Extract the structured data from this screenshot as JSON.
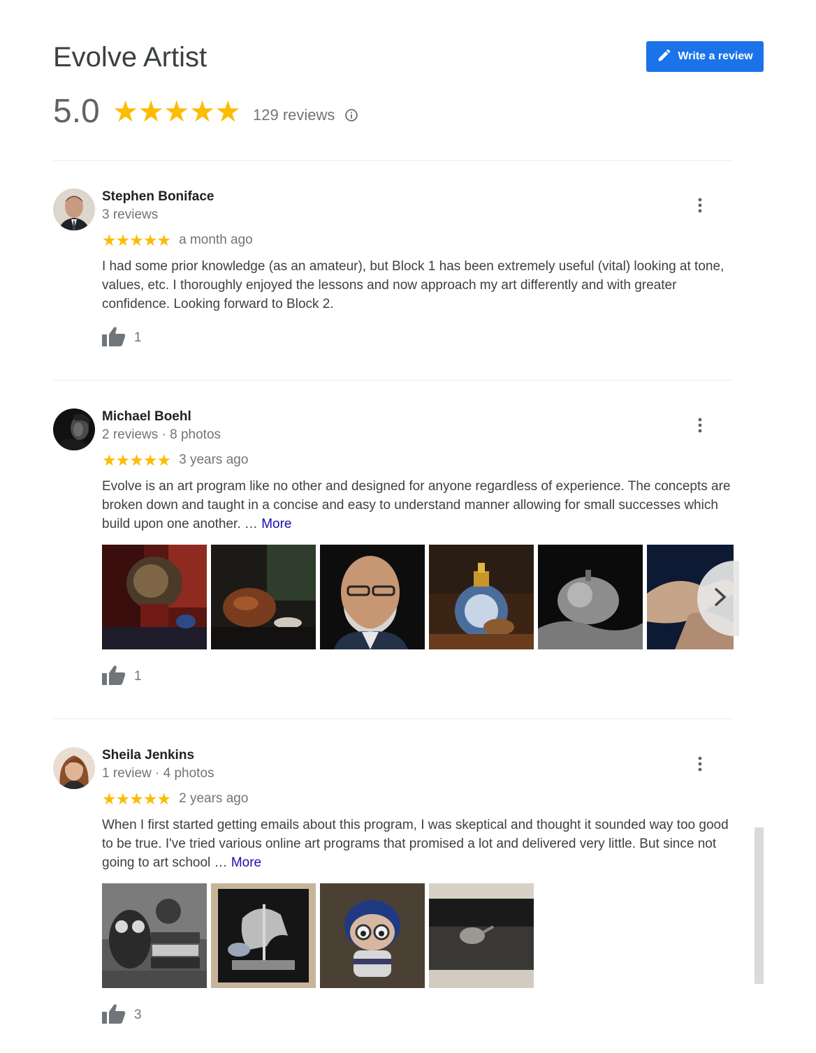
{
  "header": {
    "title": "Evolve Artist",
    "write_review_label": "Write a review",
    "rating": "5.0",
    "stars": "★★★★★",
    "review_count": "129 reviews"
  },
  "colors": {
    "accent_blue": "#1a73e8",
    "star_yellow": "#fbbc04",
    "link": "#1a0dab"
  },
  "reviews": [
    {
      "name": "Stephen Boniface",
      "meta": "3 reviews",
      "stars": "★★★★★",
      "rating": 5,
      "date": "a month ago",
      "text": "I had some prior knowledge (as an amateur), but Block 1 has been extremely useful (vital) looking at tone, values, etc.  I thoroughly enjoyed the lessons and now approach my art differently and with greater confidence.  Looking forward to Block 2.",
      "more": "",
      "likes": "1",
      "photos": []
    },
    {
      "name": "Michael Boehl",
      "meta": "2 reviews · 8 photos",
      "stars": "★★★★★",
      "rating": 5,
      "date": "3 years ago",
      "text": "Evolve is an art program like no other and designed for anyone regardless of experience. The concepts are broken down and taught in a concise and easy to understand manner allowing for small successes which build upon one another. …",
      "more": "More",
      "likes": "1",
      "photos": [
        "lion-painting",
        "teapot-painting",
        "man-portrait",
        "perfume-bottle",
        "pumpkin-painting",
        "hands-painting"
      ]
    },
    {
      "name": "Sheila Jenkins",
      "meta": "1 review · 4 photos",
      "stars": "★★★★★",
      "rating": 5,
      "date": "2 years ago",
      "text": "When I first started getting emails about this program, I was skeptical and thought it sounded way too good to be true. I've tried various online art programs that promised a lot and delivered very little. But since not going to art school …",
      "more": "More",
      "likes": "3",
      "photos": [
        "owl-books-painting",
        "carousel-horse-painting",
        "character-doll-painting",
        "kettle-painting"
      ]
    }
  ]
}
